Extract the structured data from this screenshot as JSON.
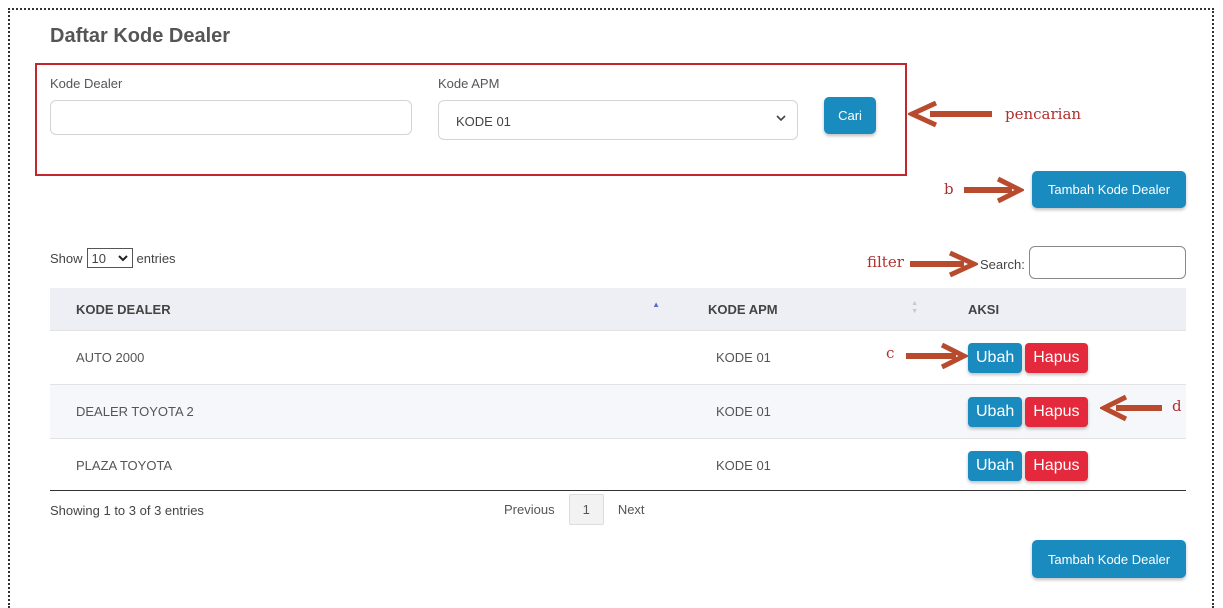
{
  "page": {
    "title": "Daftar Kode Dealer"
  },
  "search_form": {
    "kode_dealer_label": "Kode Dealer",
    "kode_dealer_value": "",
    "kode_apm_label": "Kode APM",
    "kode_apm_selected": "KODE 01",
    "cari_label": "Cari"
  },
  "add_button_label": "Tambah Kode Dealer",
  "annotations": {
    "pencarian": "pencarian",
    "b": "b",
    "filter": "filter",
    "c": "c",
    "d": "d"
  },
  "table_controls": {
    "show_label": "Show",
    "entries_value": "10",
    "entries_label": "entries",
    "search_label": "Search:"
  },
  "table": {
    "headers": [
      "KODE DEALER",
      "KODE APM",
      "AKSI"
    ],
    "rows": [
      {
        "kode_dealer": "AUTO 2000",
        "kode_apm": "KODE 01"
      },
      {
        "kode_dealer": "DEALER TOYOTA 2",
        "kode_apm": "KODE 01"
      },
      {
        "kode_dealer": "PLAZA TOYOTA",
        "kode_apm": "KODE 01"
      }
    ],
    "ubah_label": "Ubah",
    "hapus_label": "Hapus"
  },
  "pagination": {
    "info": "Showing 1 to 3 of 3 entries",
    "previous": "Previous",
    "current_page": "1",
    "next": "Next"
  },
  "colors": {
    "primary": "#1a8bbf",
    "danger": "#e3293b",
    "annotation": "#b0302f"
  }
}
